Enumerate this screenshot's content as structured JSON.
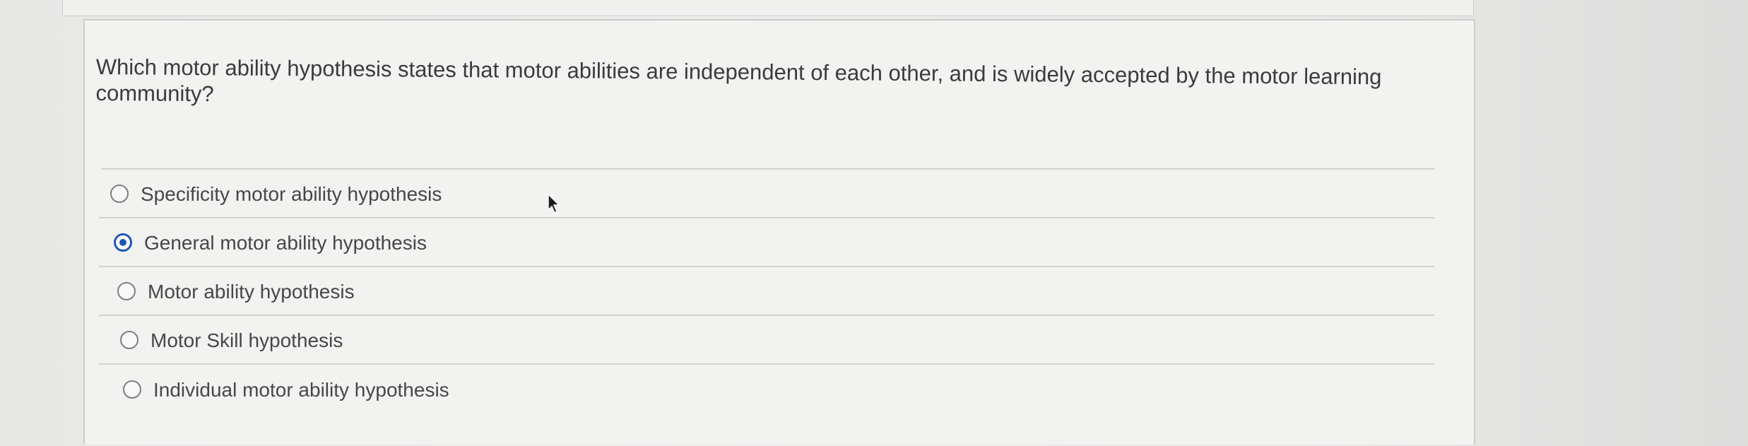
{
  "question": {
    "text": "Which motor ability hypothesis states that motor abilities are independent of each other, and is widely accepted by the motor learning community?"
  },
  "answers": [
    {
      "label": "Specificity motor ability hypothesis",
      "selected": false
    },
    {
      "label": "General motor ability hypothesis",
      "selected": true
    },
    {
      "label": "Motor ability hypothesis",
      "selected": false
    },
    {
      "label": "Motor Skill hypothesis",
      "selected": false
    },
    {
      "label": "Individual motor ability hypothesis",
      "selected": false
    }
  ],
  "colors": {
    "selected_radio": "#1f57b7",
    "text": "#474747",
    "card": "#f2f2f1"
  },
  "icons": {
    "pointer": "mouse-pointer-icon"
  }
}
